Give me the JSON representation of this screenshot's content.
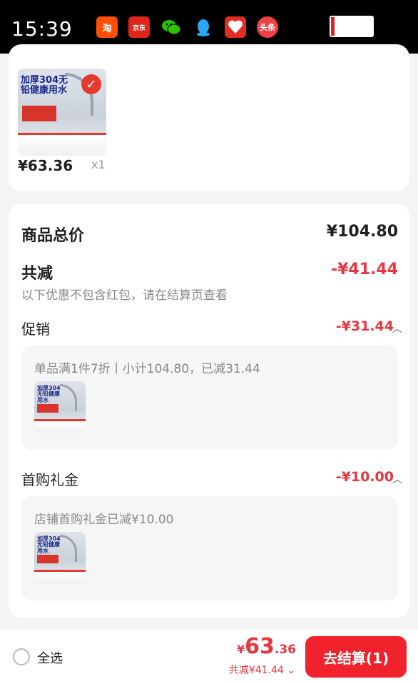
{
  "status_bar": {
    "time": "15:39",
    "apps": [
      {
        "name": "taobao-icon",
        "glyph": "淘"
      },
      {
        "name": "jd-icon",
        "glyph": "京东"
      },
      {
        "name": "wechat-icon",
        "glyph": ""
      },
      {
        "name": "qq-icon",
        "glyph": ""
      },
      {
        "name": "pinduoduo-icon",
        "glyph": ""
      },
      {
        "name": "toutiao-icon",
        "glyph": "头条"
      }
    ],
    "battery_level": 0.08
  },
  "product": {
    "thumb_heading": "加厚304无铅健康用水",
    "price": "¥63.36",
    "quantity": "x1"
  },
  "summary": {
    "total_label": "商品总价",
    "total_value": "¥104.80",
    "discount_label": "共减",
    "discount_value": "-¥41.44",
    "note": "以下优惠不包含红包，请在结算页查看"
  },
  "promotion": {
    "label": "促销",
    "value": "-¥31.44",
    "detail": "单品满1件7折丨小计104.80，已减31.44"
  },
  "first_purchase": {
    "label": "首购礼金",
    "value": "-¥10.00",
    "detail": "店铺首购礼金已减¥10.00"
  },
  "footer": {
    "select_all": "全选",
    "price_currency": "¥",
    "price_int": "63",
    "price_dec": ".36",
    "saved_text": "共减¥41.44 ⌄",
    "checkout_label": "去结算(1)"
  },
  "colors": {
    "accent_red": "#e8363f",
    "checkout_red": "#f0232d"
  }
}
